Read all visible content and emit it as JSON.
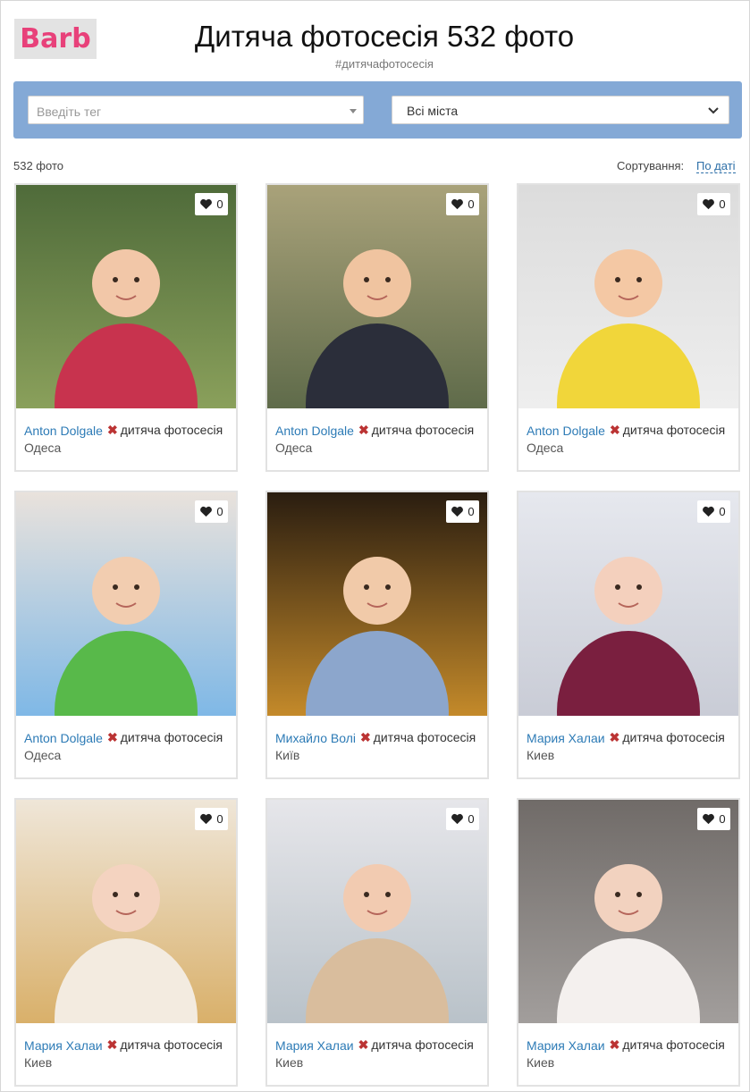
{
  "logo": {
    "text": "Barb"
  },
  "header": {
    "title": "Дитяча фотосесія 532 фото",
    "hashtag": "#дитячафотосесія"
  },
  "filters": {
    "tag_placeholder": "Введіть тег",
    "city_value": "Всі міста"
  },
  "results": {
    "count": "532 фото",
    "sort_label": "Сортування:",
    "sort_value": "По даті"
  },
  "cards": [
    {
      "author": "Anton Dolgale",
      "tag": "дитяча фотосесія",
      "city": "Одеса",
      "likes": "0"
    },
    {
      "author": "Anton Dolgale",
      "tag": "дитяча фотосесія",
      "city": "Одеса",
      "likes": "0"
    },
    {
      "author": "Anton Dolgale",
      "tag": "дитяча фотосесія",
      "city": "Одеса",
      "likes": "0"
    },
    {
      "author": "Anton Dolgale",
      "tag": "дитяча фотосесія",
      "city": "Одеса",
      "likes": "0"
    },
    {
      "author": "Михайло Волі",
      "tag": "дитяча фотосесія",
      "city": "Київ",
      "likes": "0"
    },
    {
      "author": "Мария Халаи",
      "tag": "дитяча фотосесія",
      "city": "Киев",
      "likes": "0"
    },
    {
      "author": "Мария Халаи",
      "tag": "дитяча фотосесія",
      "city": "Киев",
      "likes": "0"
    },
    {
      "author": "Мария Халаи",
      "tag": "дитяча фотосесія",
      "city": "Киев",
      "likes": "0"
    },
    {
      "author": "Мария Халаи",
      "tag": "дитяча фотосесія",
      "city": "Киев",
      "likes": "0"
    }
  ],
  "colors": {
    "accent": "#84a9d6",
    "link": "#2d7bb6",
    "logo": "#e8417a",
    "remove": "#b33333"
  },
  "icons": {
    "like": "heart-icon",
    "remove": "close-icon",
    "tag_dropdown": "caret-down-icon",
    "city_dropdown": "chevron-down-icon"
  }
}
